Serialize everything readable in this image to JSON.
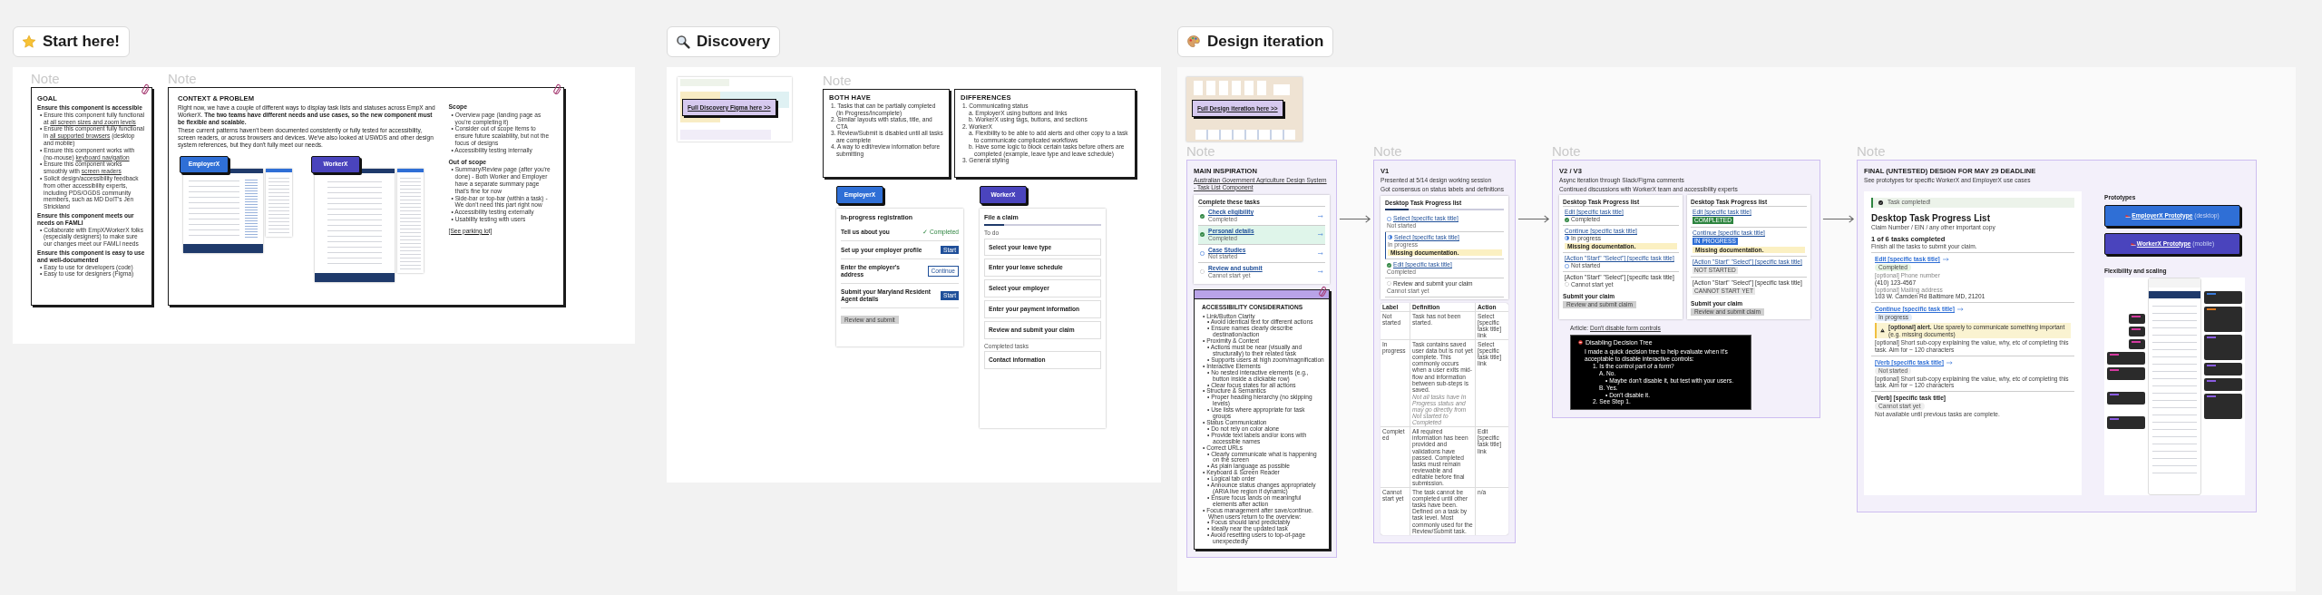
{
  "start_here": {
    "title": "Start here!",
    "goal": {
      "note": "Note",
      "heading": "GOAL",
      "groups": [
        {
          "title": "Ensure this component is accessible",
          "items": [
            [
              {
                "text": "• Ensure this component fully functional at "
              },
              {
                "text": "all screen sizes and zoom levels",
                "link": true
              }
            ],
            [
              {
                "text": "• Ensure this component fully functional in "
              },
              {
                "text": "all supported browsers",
                "link": true
              },
              {
                "text": " (desktop and mobile)"
              }
            ],
            [
              {
                "text": "• Ensure this component works with (no-mouse) "
              },
              {
                "text": "keyboard navigation",
                "link": true
              }
            ],
            [
              {
                "text": "• Ensure this component works smoothly with "
              },
              {
                "text": "screen readers",
                "link": true
              }
            ],
            [
              {
                "text": "• Solicit design/accessibility feedback from other accessibility experts, including PDS/OGDS community members, such as MD DoIT's Jen Strickland"
              }
            ]
          ]
        },
        {
          "title": "Ensure this component meets our needs on FAMLI",
          "items": [
            [
              {
                "text": "• Collaborate with EmpX/WorkerX folks (especially designers) to make sure our changes meet our FAMLI needs"
              }
            ]
          ]
        },
        {
          "title": "Ensure this component is easy to use and well-documented",
          "items": [
            [
              {
                "text": "• Easy to use for developers (code)"
              }
            ],
            [
              {
                "text": "• Easy to use for designers (Figma)"
              }
            ]
          ]
        }
      ]
    },
    "context": {
      "note": "Note",
      "heading": "CONTEXT & PROBLEM",
      "paragraphs": [
        "Right now, we have a couple of different ways to display task lists and statuses across EmpX and WorkerX. **The two teams have different needs and use cases, so the new component must be flexible and scalable.**",
        "These current patterns haven't been documented consistently or fully tested for accessibility, screen readers, or across browsers and devices. We've also looked at USWDS and other design system references, but they don't fully meet our needs."
      ],
      "products": [
        {
          "label": "EmployerX",
          "color": "#2f6fd6"
        },
        {
          "label": "WorkerX",
          "color": "#4a44bd"
        }
      ],
      "scope": [
        {
          "title": "Scope",
          "items": [
            "• Overview page (landing page as you're completing it)",
            "• Consider out of scope items to ensure future scalability, but not the focus of designs",
            "• Accessibility testing internally"
          ]
        },
        {
          "title": "Out of scope",
          "items": [
            "• Summary/Review page (after you're done) - Both Worker and Employer have a separate summary page that's fine for now",
            "• Side-bar or top-bar (within a task) - We don't need this part right now",
            "• Accessibility testing externally",
            "• Usability testing with users"
          ]
        }
      ],
      "parking_lot_link": "[See parking lot]"
    }
  },
  "discovery": {
    "title": "Discovery",
    "figma_link": "Full Discovery Figma here >>",
    "note": "Note",
    "cards": [
      {
        "heading": "BOTH HAVE",
        "items": [
          {
            "text": "1. Tasks that can be partially completed (In Progress/Incomplete)"
          },
          {
            "text": "2. Similar layouts with status, title, and CTA"
          },
          {
            "text": "3. Review/Submit is disabled until all tasks are complete"
          },
          {
            "text": "4. A way to edit/review information before submitting"
          }
        ]
      },
      {
        "heading": "DIFFERENCES",
        "items": [
          {
            "text": "1. Communicating status",
            "children": [
              {
                "text": "a. EmployerX using buttons and links"
              },
              {
                "text": "b. WorkerX using tags, buttons, and sections"
              }
            ]
          },
          {
            "text": "2. WorkerX",
            "children": [
              {
                "text": "a. Flexibility to be able to add alerts and other copy to a task to communicate complicated workflows"
              },
              {
                "text": "b. Have some logic to block certain tasks before others are completed (example, leave type and leave schedule)"
              }
            ]
          },
          {
            "text": "3. General styling"
          }
        ]
      }
    ],
    "employer": {
      "tag": "EmployerX",
      "color": "#2f6fd6",
      "title": "In-progress registration",
      "tasks": [
        {
          "title": "Tell us about you",
          "action": "✓ Completed",
          "kind": "status"
        },
        {
          "title": "Set up your employer profile",
          "action": "Start",
          "kind": "primary"
        },
        {
          "title": "Enter the employer's address",
          "action": "Continue",
          "kind": "outline"
        },
        {
          "title": "Submit your Maryland Resident Agent details",
          "action": "Start",
          "kind": "primary"
        }
      ],
      "submit": "Review and submit"
    },
    "worker": {
      "tag": "WorkerX",
      "color": "#4a44bd",
      "title": "File a claim",
      "progress": {
        "level": 0.17
      },
      "todo_heading": "To do",
      "todo_tasks": [
        "Select your leave type",
        "Enter your leave schedule",
        "Select your employer",
        "Enter your payment information",
        "Review and submit your claim"
      ],
      "done_heading": "Completed tasks",
      "done_tasks": [
        "Contact information"
      ]
    }
  },
  "design_iteration": {
    "title": "Design iteration",
    "figma_link": "Full Design iteration here >>",
    "inspiration": {
      "note": "Note",
      "heading": "MAIN INSPIRATION",
      "link": "Australian Government Agriculture Design System - Task List Component",
      "sample": {
        "title": "Complete these tasks",
        "rows": [
          {
            "title": "Check eligibility",
            "kind": "completed",
            "label": "Completed",
            "selected": false
          },
          {
            "title": "Personal details",
            "kind": "completed",
            "label": "Completed",
            "selected": true
          },
          {
            "title": "Case Studies",
            "kind": "not_started",
            "label": "Not started",
            "selected": false
          },
          {
            "title": "Review and submit",
            "kind": "cannot_start",
            "label": "Cannot start yet",
            "selected": false
          }
        ]
      },
      "a11y": {
        "heading": "ACCESSIBILITY CONSIDERATIONS",
        "items": [
          {
            "text": "• Link/Button Clarity",
            "children": [
              {
                "text": "• Avoid identical text for different actions"
              },
              {
                "text": "• Ensure names clearly describe destination/action"
              }
            ]
          },
          {
            "text": "• Proximity & Context",
            "children": [
              {
                "text": "• Actions must be near (visually and structurally) to their related task"
              },
              {
                "text": "• Supports users at high zoom/magnification"
              }
            ]
          },
          {
            "text": "• Interactive Elements",
            "children": [
              {
                "text": "• No nested interactive elements (e.g., button inside a clickable row)"
              },
              {
                "text": "• Clear focus states for all actions"
              }
            ]
          },
          {
            "text": "• Structure & Semantics",
            "children": [
              {
                "text": "• Proper heading hierarchy (no skipping levels)"
              },
              {
                "text": "• Use lists where appropriate for task groups"
              }
            ]
          },
          {
            "text": "• Status Communication",
            "children": [
              {
                "text": "• Do not rely on color alone"
              },
              {
                "text": "• Provide text labels and/or icons with accessible names"
              }
            ]
          },
          {
            "text": "• Correct URLs",
            "children": [
              {
                "text": "• Clearly communicate what is happening on the screen"
              },
              {
                "text": "• As plain language as possible"
              }
            ]
          },
          {
            "text": "• Keyboard & Screen Reader",
            "children": [
              {
                "text": "• Logical tab order"
              },
              {
                "text": "• Announce status changes appropriately (ARIA live region if dynamic)"
              },
              {
                "text": "• Ensure focus lands on meaningful elements after action"
              }
            ]
          },
          {
            "text": "• Focus management after save/continue. When users return to the overview:",
            "children": [
              {
                "text": "• Focus should land predictably"
              },
              {
                "text": "• Ideally near the updated task"
              },
              {
                "text": "• Avoid resetting users to top-of-page unexpectedly"
              }
            ]
          }
        ]
      }
    },
    "v1": {
      "note": "Note",
      "heading": "V1",
      "lines": [
        "Presented at 5/14 design working session",
        "Got consensus on status labels and definitions"
      ],
      "sample": {
        "title": "Desktop Task Progress list",
        "progress": {
          "level": 0.2
        },
        "tasks": [
          {
            "title": "Select [specific task title]",
            "kind": "not_started",
            "label": "Not started"
          },
          {
            "title": "Select [specific task title]",
            "kind": "in_progress",
            "label": "In progress",
            "alert": "Missing documentation."
          },
          {
            "title": "Edit [specific task title]",
            "kind": "completed",
            "label": "Completed"
          },
          {
            "title": "Review and submit your claim",
            "kind": "cannot_start",
            "label": "Cannot start yet"
          }
        ]
      },
      "table": {
        "columns": [
          "Label",
          "Definition",
          "Action"
        ],
        "rows": [
          {
            "cells": [
              "Not started",
              "Task has not been started.",
              "Select [specific task title] link"
            ]
          },
          {
            "cells": [
              "In progress",
              "Task contains saved user data but is not yet complete. This commonly occurs when a user exits mid-flow and information between sub-steps is saved.",
              "Select [specific task title] link"
            ],
            "note": "Not all tasks have In Progress status and may go directly from Not started to Completed"
          },
          {
            "cells": [
              "Completed",
              "All required information has been provided and validations have passed. Completed tasks must remain reviewable and editable before final submission.",
              "Edit [specific task title] link"
            ]
          },
          {
            "cells": [
              "Cannot start yet",
              "The task cannot be completed until other tasks have been. Defined on a task by task level. Most commonly used for the Review/Submit task.",
              "n/a"
            ]
          }
        ]
      }
    },
    "v2": {
      "note": "Note",
      "heading": "V2 / V3",
      "lines": [
        "Async iteration through Slack/Figma comments",
        "Continued discussions with WorkerX team and accessibility experts"
      ],
      "samples": [
        {
          "kind": "icons",
          "title": "Desktop Task Progress list",
          "tasks": [
            {
              "title": "Edit [specific task title]",
              "kind": "completed",
              "label": "Completed"
            },
            {
              "title": "Continue [specific task title]",
              "kind": "in_progress",
              "label": "In progress",
              "alert": "Missing documentation."
            },
            {
              "title": "[Action \"Start\" \"Select\"] [specific task title]",
              "kind": "not_started",
              "label": "Not started"
            },
            {
              "title": "[Action \"Start\" \"Select\"] [specific task title]",
              "kind": "cannot_start",
              "label": "Cannot start yet"
            }
          ],
          "submit_title": "Submit your claim",
          "submit_button": "Review and submit claim"
        },
        {
          "kind": "tags",
          "title": "Desktop Task Progress list",
          "tasks": [
            {
              "title": "Edit [specific task title]",
              "kind": "completed",
              "label": "COMPLETED"
            },
            {
              "title": "Continue [specific task title]",
              "kind": "in_progress",
              "label": "IN PROGRESS",
              "alert": "Missing documentation."
            },
            {
              "title": "[Action \"Start\" \"Select\"] [specific task title]",
              "kind": "not_started",
              "label": "NOT STARTED"
            },
            {
              "title": "[Action \"Start\" \"Select\"] [specific task title]",
              "kind": "cannot_start",
              "label": "CANNOT START YET"
            }
          ],
          "submit_title": "Submit your claim",
          "submit_button": "Review and submit claim"
        }
      ],
      "article_label": "Article:",
      "article_link": "Don't disable form controls",
      "tree": {
        "title": "Disabling Decision Tree",
        "intro": "I made a quick decision tree to help evaluate when it's acceptable to disable interactive controls:",
        "items": [
          {
            "text": "1. Is the control part of a form?",
            "children": [
              {
                "text": "A. No.",
                "children": [
                  {
                    "text": "• Maybe don't disable it, but test with your users."
                  }
                ]
              },
              {
                "text": "B. Yes.",
                "children": [
                  {
                    "text": "• Don't disable it."
                  }
                ]
              }
            ]
          },
          {
            "text": "2. See Step 1."
          }
        ]
      }
    },
    "final": {
      "note": "Note",
      "heading": "FINAL (UNTESTED) DESIGN FOR MAY 29 DEADLINE",
      "subtitle": "See prototypes for specific WorkerX and EmployerX use cases",
      "sample": {
        "banner": "Task completed!",
        "title": "Desktop Task Progress List",
        "meta": "Claim Number / EIN / any other important copy",
        "progress": "1 of 6 tasks completed",
        "hint": "Finish all the tasks to submit your claim.",
        "tasks": [
          {
            "kind": "completed",
            "title": "Edit [specific task title]",
            "label": "Completed",
            "details": [
              {
                "label": "[optional] Phone number",
                "value": "(410) 123-4567"
              },
              {
                "label": "[optional] Mailing address",
                "value": "103 W. Camden Rd Baltimore MD, 21201"
              }
            ]
          },
          {
            "kind": "in_progress",
            "title": "Continue [specific task title]",
            "label": "In progress",
            "alert": "**[optional] alert.** Use sparely to communicate something important (e.g. missing documents)",
            "sub": "[optional] Short sub-copy explaining the value, why, etc of completing this task. Aim for ~ 120 characters"
          },
          {
            "kind": "not_started",
            "title": "[Verb [specific task title]",
            "label": "Not started",
            "sub": "[optional] Short sub-copy explaining the value, why, etc of completing this task. Aim for ~ 120 characters"
          },
          {
            "kind": "cannot_start",
            "title": "[Verb] [specific task title]",
            "label": "Cannot start yet",
            "sub": "Not available until previous tasks are complete."
          }
        ]
      },
      "prototypes_heading": "Prototypes",
      "prototypes": [
        {
          "name": "EmployerX Prototype",
          "device": "(desktop)",
          "color": "#2f6fd6"
        },
        {
          "name": "WorkerX Prototype",
          "device": "(mobile)",
          "color": "#4a44bd"
        }
      ],
      "scaling_heading": "Flexibility and scaling"
    }
  }
}
